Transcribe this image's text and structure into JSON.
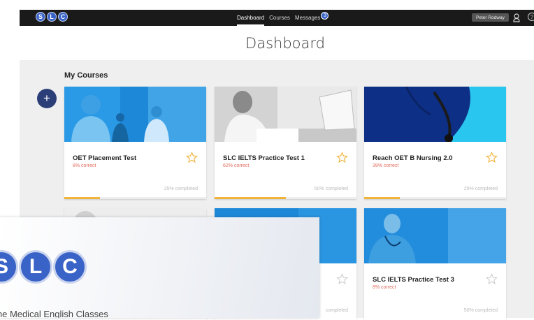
{
  "header": {
    "logo_letters": [
      "S",
      "L",
      "C"
    ],
    "nav": [
      {
        "label": "Dashboard",
        "active": true
      },
      {
        "label": "Courses",
        "active": false
      },
      {
        "label": "Messages",
        "active": false
      }
    ],
    "messages_badge": "3",
    "user_name": "Peter Rodway",
    "help_glyph": "?"
  },
  "page_title": "Dashboard",
  "section_title": "My Courses",
  "add_button_glyph": "+",
  "courses": [
    {
      "title": "OET Placement Test",
      "score": "8% correct",
      "completed": "25% completed",
      "progress": 0.25,
      "image": "blue-tinted medical staff photo"
    },
    {
      "title": "SLC IELTS Practice Test 1",
      "score": "62% correct",
      "completed": "50% completed",
      "progress": 0.5,
      "image": "grayscale student writing photo"
    },
    {
      "title": "Reach OET B Nursing 2.0",
      "score": "39% correct",
      "completed": "25% completed",
      "progress": 0.25,
      "image": "navy scrubs with stethoscope photo"
    },
    {
      "title": "",
      "score": "",
      "completed": "",
      "progress": 0,
      "image": "grayscale portrait photo"
    },
    {
      "title": "",
      "score": "",
      "completed": "completed",
      "progress": 0,
      "image": "blue-tinted photo"
    },
    {
      "title": "SLC IELTS Practice Test 3",
      "score": "8% correct",
      "completed": "50% completed",
      "progress": 0,
      "image": "blue-tinted nurse photo"
    }
  ],
  "popup": {
    "logo_letters": [
      "S",
      "L",
      "C"
    ],
    "tagline": "ine Medical English Classes"
  },
  "colors": {
    "brand_blue": "#3a63c8",
    "add_button": "#2c3e78",
    "score_red": "#e36a5c",
    "progress": "#f0b43a"
  }
}
